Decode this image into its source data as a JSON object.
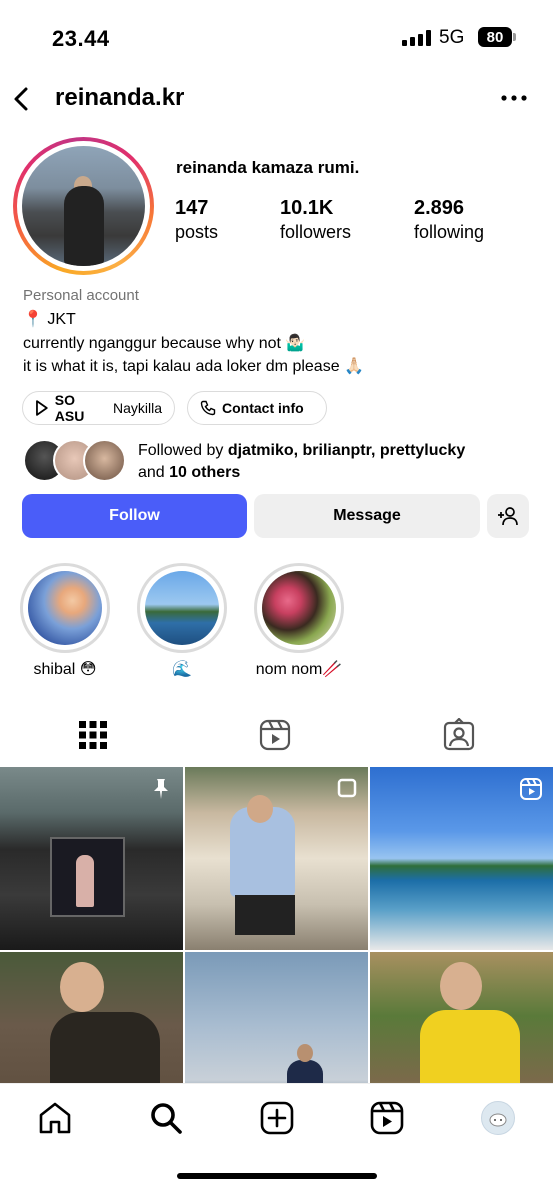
{
  "status_bar": {
    "time": "23.44",
    "network": "5G",
    "battery": "80"
  },
  "header": {
    "username": "reinanda.kr"
  },
  "profile": {
    "full_name": "reinanda kamaza rumi.",
    "stats": [
      {
        "value": "147",
        "label": "posts"
      },
      {
        "value": "10.1K",
        "label": "followers"
      },
      {
        "value": "2.896",
        "label": "following"
      }
    ],
    "category": "Personal account",
    "bio": [
      "📍 JKT",
      "currently nganggur because why not 🤷🏻‍♂️",
      "it is what it is, tapi kalau ada loker dm please 🙏🏻"
    ],
    "chips": [
      {
        "bold": "SO ASU",
        "text": "Naykilla"
      },
      {
        "bold": "Contact info",
        "text": ""
      }
    ],
    "followed_by": {
      "prefix": "Followed by ",
      "names": "djatmiko, brilianptr, prettylucky",
      "and": "and ",
      "others": "10 others"
    },
    "buttons": {
      "follow": "Follow",
      "message": "Message"
    }
  },
  "highlights": [
    {
      "label": "shibal 😳"
    },
    {
      "label": "🌊"
    },
    {
      "label": "nom nom🥢"
    }
  ],
  "tabs": [
    "grid-icon",
    "reels-icon",
    "tagged-icon"
  ],
  "nav": [
    "home-icon",
    "search-icon",
    "create-icon",
    "reels-icon",
    "profile-avatar"
  ],
  "colors": {
    "follow_button": "#4a5df9",
    "secondary_button": "#efefef",
    "muted_text": "#737373"
  }
}
